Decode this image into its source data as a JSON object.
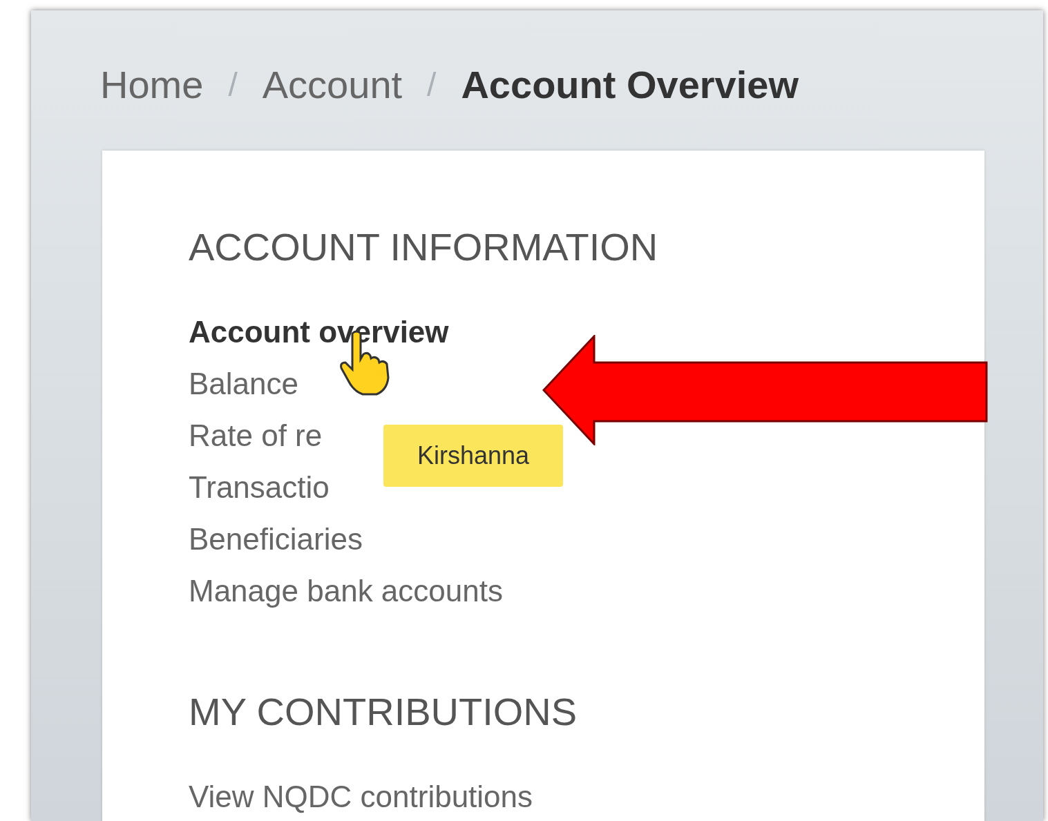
{
  "breadcrumb": {
    "items": [
      {
        "label": "Home",
        "current": false
      },
      {
        "label": "Account",
        "current": false
      },
      {
        "label": "Account Overview",
        "current": true
      }
    ],
    "separators": [
      "/",
      "/"
    ]
  },
  "sections": [
    {
      "heading": "ACCOUNT INFORMATION",
      "links": [
        {
          "label": "Account overview",
          "selected": true
        },
        {
          "label": "Balance",
          "selected": false
        },
        {
          "label": "Rate of re",
          "selected": false
        },
        {
          "label": "Transactio",
          "selected": false
        },
        {
          "label": "Beneficiaries",
          "selected": false
        },
        {
          "label": "Manage bank accounts",
          "selected": false
        }
      ]
    },
    {
      "heading": "MY CONTRIBUTIONS",
      "links": [
        {
          "label": "View NQDC contributions",
          "selected": false
        }
      ]
    }
  ],
  "tooltip": {
    "text": "Kirshanna"
  }
}
